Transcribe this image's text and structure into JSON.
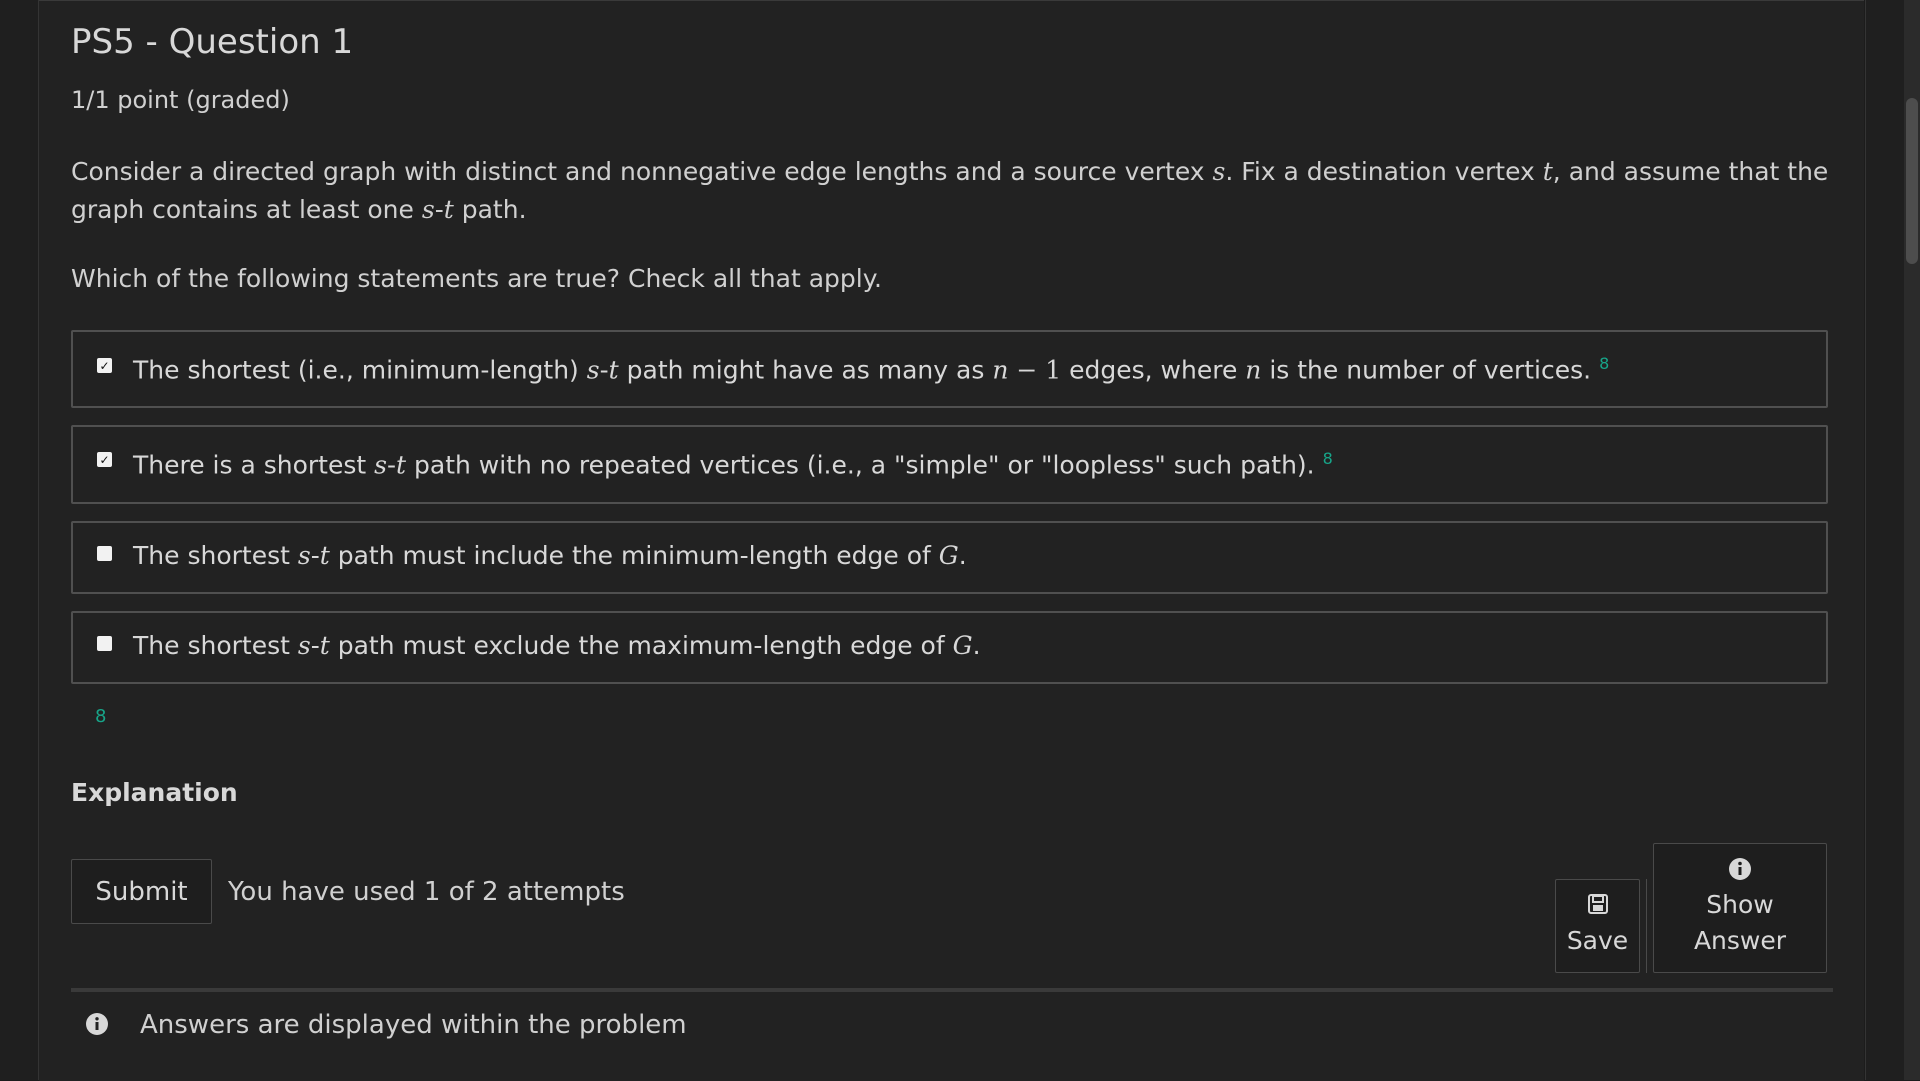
{
  "problem": {
    "title": "PS5 - Question 1",
    "points": "1/1 point (graded)",
    "prompt_parts": {
      "p1": "Consider a directed graph with distinct and nonnegative edge lengths and a source vertex ",
      "s": "s",
      "p2": ". Fix a destination vertex ",
      "t": "t",
      "p3": ", and assume that the graph contains at least one ",
      "st": "s",
      "dash": "-",
      "st2": "t",
      "p4": " path."
    },
    "instruction": "Which of the following statements are true? Check all that apply."
  },
  "choices": [
    {
      "checked": true,
      "a": "The shortest (i.e., minimum-length) ",
      "m1": "s",
      "dash": "-",
      "m2": "t",
      "b": " path might have as many as ",
      "m3": "n",
      "op": " − 1",
      "c": " edges, where ",
      "m4": "n",
      "d": " is the number of vertices."
    },
    {
      "checked": true,
      "a": "There is a shortest ",
      "m1": "s",
      "dash": "-",
      "m2": "t",
      "b": " path with no repeated vertices (i.e., a \"simple\" or \"loopless\" such path)."
    },
    {
      "checked": false,
      "a": "The shortest ",
      "m1": "s",
      "dash": "-",
      "m2": "t",
      "b": " path must include the minimum-length edge of ",
      "m3": "G",
      "c": "."
    },
    {
      "checked": false,
      "a": "The shortest ",
      "m1": "s",
      "dash": "-",
      "m2": "t",
      "b": " path must exclude the maximum-length edge of ",
      "m3": "G",
      "c": "."
    }
  ],
  "correct_mark": "8",
  "explanation_label": "Explanation",
  "actions": {
    "submit": "Submit",
    "attempts": "You have used 1 of 2 attempts",
    "save": "Save",
    "show_answer_1": "Show",
    "show_answer_2": "Answer"
  },
  "notification": "Answers are displayed within the problem",
  "icons": {
    "save": "floppy-disk-icon",
    "show_answer": "info-circle-icon",
    "notification": "info-circle-icon"
  },
  "colors": {
    "background": "#222222",
    "correct": "#17a589",
    "border": "#505050"
  }
}
